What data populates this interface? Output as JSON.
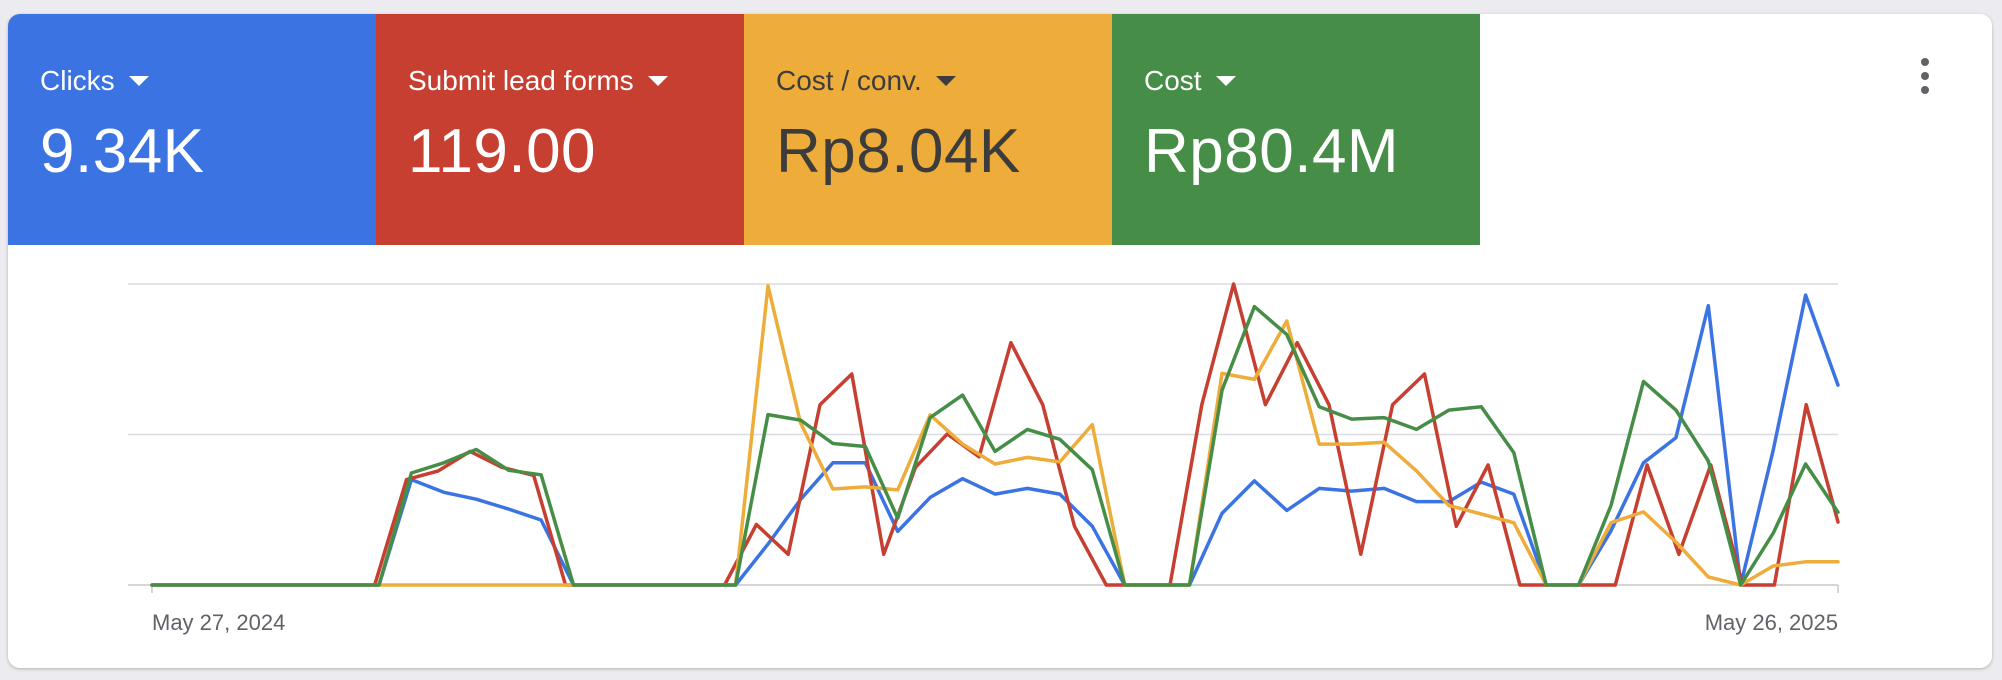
{
  "header": {
    "tiles": [
      {
        "label": "Clicks",
        "value": "9.34K",
        "color": "#3b74e2"
      },
      {
        "label": "Submit lead forms",
        "value": "119.00",
        "color": "#c63f31"
      },
      {
        "label": "Cost / conv.",
        "value": "Rp8.04K",
        "color": "#eead3b"
      },
      {
        "label": "Cost",
        "value": "Rp80.4M",
        "color": "#468e47"
      }
    ],
    "more_icon": "more-vert-icon"
  },
  "chart_data": {
    "type": "line",
    "x_range": [
      "2024-05-27",
      "2025-05-26"
    ],
    "x_tick_labels": [
      "May 27, 2024",
      "May 26, 2025"
    ],
    "y_normalized": true,
    "ylim": [
      0,
      100
    ],
    "grid": true,
    "series": [
      {
        "name": "Clicks",
        "color": "#3b74e2",
        "values": [
          0,
          0,
          0,
          0,
          0,
          0,
          0,
          0,
          35,
          30.8,
          28.5,
          25.2,
          21.6,
          0,
          0,
          0,
          0,
          0,
          0,
          13.6,
          28.4,
          40.6,
          40.6,
          17.8,
          29.1,
          35.3,
          30.2,
          32.1,
          30.2,
          19.5,
          0,
          0,
          0,
          23.8,
          34.6,
          24.8,
          32.1,
          31.2,
          32.1,
          27.7,
          27.7,
          34.2,
          30.2,
          0,
          0,
          18,
          40.6,
          48.9,
          92.8,
          0,
          44.8,
          96.3,
          66.4
        ]
      },
      {
        "name": "Submit lead forms",
        "color": "#c63f31",
        "values": [
          0,
          0,
          0,
          0,
          0,
          0,
          0,
          0,
          35,
          37.9,
          44.4,
          39.1,
          36.4,
          0,
          0,
          0,
          0,
          0,
          0,
          20.1,
          10.2,
          59.9,
          70.1,
          10.2,
          39.1,
          50.2,
          42.6,
          80.5,
          59.9,
          19.5,
          0,
          0,
          0,
          59.9,
          100,
          59.9,
          80.5,
          59.9,
          10.2,
          59.9,
          70.1,
          19.5,
          39.9,
          0,
          0,
          0,
          0,
          39.9,
          10.2,
          39.9,
          0,
          0,
          59.9,
          20.9
        ]
      },
      {
        "name": "Cost / conv.",
        "color": "#eead3b",
        "values": [
          0,
          0,
          0,
          0,
          0,
          0,
          0,
          0,
          0,
          0,
          0,
          0,
          0,
          0,
          0,
          0,
          0,
          0,
          0,
          99.4,
          53.9,
          31.9,
          32.6,
          31.6,
          56.5,
          46.8,
          40.2,
          42.4,
          40.9,
          53.3,
          0,
          0,
          0,
          70.3,
          68.3,
          87.7,
          46.8,
          46.8,
          47.4,
          37.9,
          26.4,
          23.6,
          20.7,
          0,
          0,
          20.7,
          24.3,
          14.3,
          2.7,
          0,
          6.3,
          7.7,
          7.7
        ]
      },
      {
        "name": "Cost",
        "color": "#468e47",
        "values": [
          0,
          0,
          0,
          0,
          0,
          0,
          0,
          0,
          37.2,
          40.6,
          45,
          38.1,
          36.6,
          0,
          0,
          0,
          0,
          0,
          0,
          56.6,
          54.8,
          47,
          46,
          22.2,
          55.6,
          63.1,
          44.4,
          51.7,
          48.4,
          38.3,
          0,
          0,
          0,
          64.7,
          92.5,
          83.2,
          59.2,
          55.1,
          55.6,
          51.7,
          58.1,
          59.2,
          44,
          0,
          0,
          26.4,
          67.6,
          58.1,
          41.2,
          0,
          17.2,
          40.2,
          24.2
        ]
      }
    ]
  }
}
